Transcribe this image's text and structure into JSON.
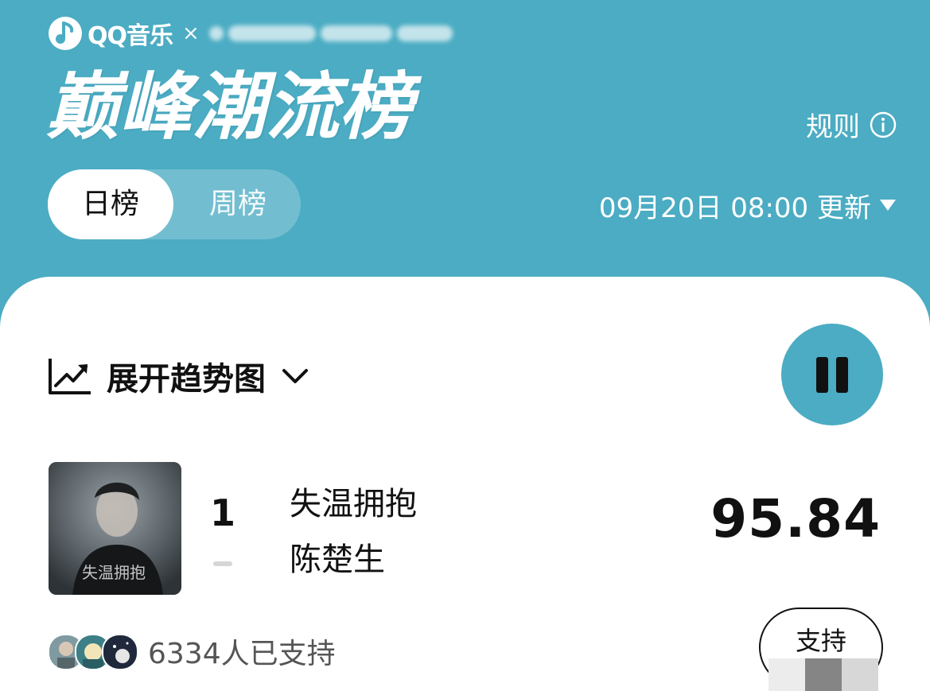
{
  "header": {
    "brand": {
      "logo_icon": "qq-music-logo-icon",
      "name": "QQ音乐",
      "separator": "×"
    },
    "title": "巅峰潮流榜",
    "rules": {
      "label": "规则",
      "icon": "info-icon"
    },
    "tabs": [
      {
        "label": "日榜",
        "active": true
      },
      {
        "label": "周榜",
        "active": false
      }
    ],
    "updated": {
      "label": "09月20日 08:00 更新",
      "icon": "caret-down-icon"
    }
  },
  "card": {
    "trend": {
      "icon": "trend-chart-icon",
      "label": "展开趋势图",
      "chevron": "chevron-down-icon"
    },
    "player": {
      "state": "playing",
      "icon": "pause-icon"
    },
    "entry": {
      "rank": "1",
      "rank_change": "unchanged",
      "title": "失温拥抱",
      "artist": "陈楚生",
      "score": "95.84",
      "cover_text": "失温拥抱"
    },
    "supporters": {
      "count_label": "6334人已支持"
    },
    "support_button": {
      "label": "支持"
    }
  },
  "colors": {
    "accent": "#4bacc3",
    "card_bg": "#ffffff",
    "text": "#111111"
  }
}
